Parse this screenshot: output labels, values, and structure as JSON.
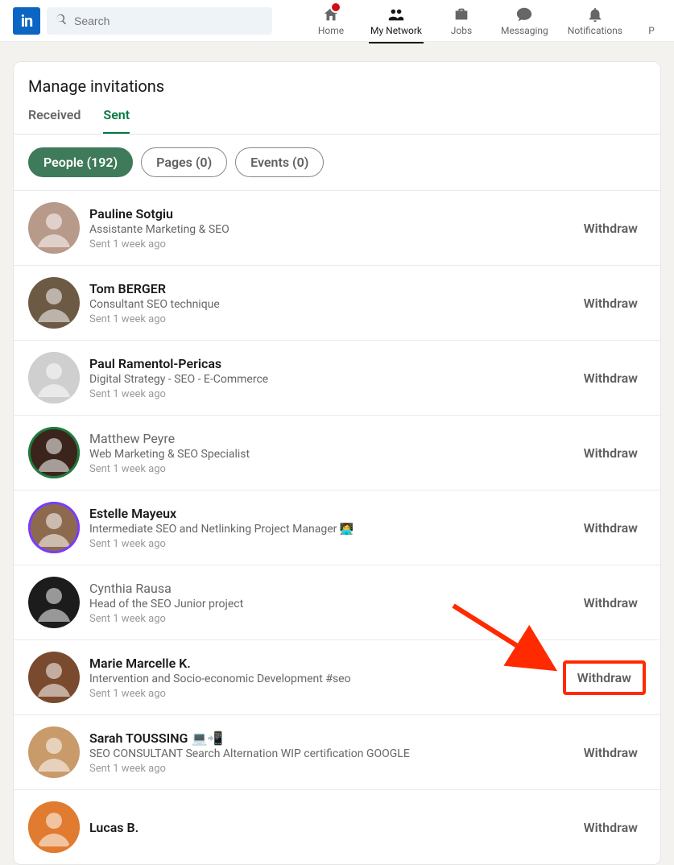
{
  "search": {
    "placeholder": "Search"
  },
  "nav": {
    "home": "Home",
    "network": "My Network",
    "jobs": "Jobs",
    "messaging": "Messaging",
    "notifications": "Notifications",
    "more": "P"
  },
  "page": {
    "title": "Manage invitations",
    "tabs": {
      "received": "Received",
      "sent": "Sent"
    },
    "pills": {
      "people": "People (192)",
      "pages": "Pages (0)",
      "events": "Events (0)"
    },
    "withdraw_label": "Withdraw"
  },
  "invitations": [
    {
      "name": "Pauline Sotgiu",
      "headline": "Assistante Marketing & SEO",
      "time": "Sent 1 week ago",
      "avatar_hue": "#b89a8a"
    },
    {
      "name": "Tom BERGER",
      "headline": "Consultant SEO technique",
      "time": "Sent 1 week ago",
      "avatar_hue": "#6c5a44"
    },
    {
      "name": "Paul Ramentol-Pericas",
      "headline": "Digital Strategy - SEO - E-Commerce",
      "time": "Sent 1 week ago",
      "avatar_hue": "#cfcfcf"
    },
    {
      "name": "Matthew Peyre",
      "headline": "Web Marketing & SEO Specialist",
      "time": "Sent 1 week ago",
      "avatar_hue": "#3b241b",
      "ring": "green",
      "name_light": true
    },
    {
      "name": "Estelle Mayeux",
      "headline": "Intermediate SEO and Netlinking Project Manager        👩‍💻",
      "time": "Sent 1 week ago",
      "avatar_hue": "#8d6a4e",
      "ring": "purple"
    },
    {
      "name": "Cynthia Rausa",
      "headline": "Head of the SEO Junior project",
      "time": "Sent 1 week ago",
      "avatar_hue": "#1c1c1c",
      "name_light": true
    },
    {
      "name": "Marie Marcelle K.",
      "headline": "Intervention and Socio-economic Development #seo",
      "time": "Sent 1 week ago",
      "avatar_hue": "#7a4a2e",
      "highlight": true
    },
    {
      "name": "Sarah TOUSSING 💻📲",
      "headline": "SEO CONSULTANT Search Alternation WIP certification GOOGLE",
      "time": "Sent 1 week ago",
      "avatar_hue": "#c99a6a"
    },
    {
      "name": "Lucas B.",
      "headline": "",
      "time": "",
      "avatar_hue": "#e07b2f",
      "ring": "orange"
    }
  ]
}
